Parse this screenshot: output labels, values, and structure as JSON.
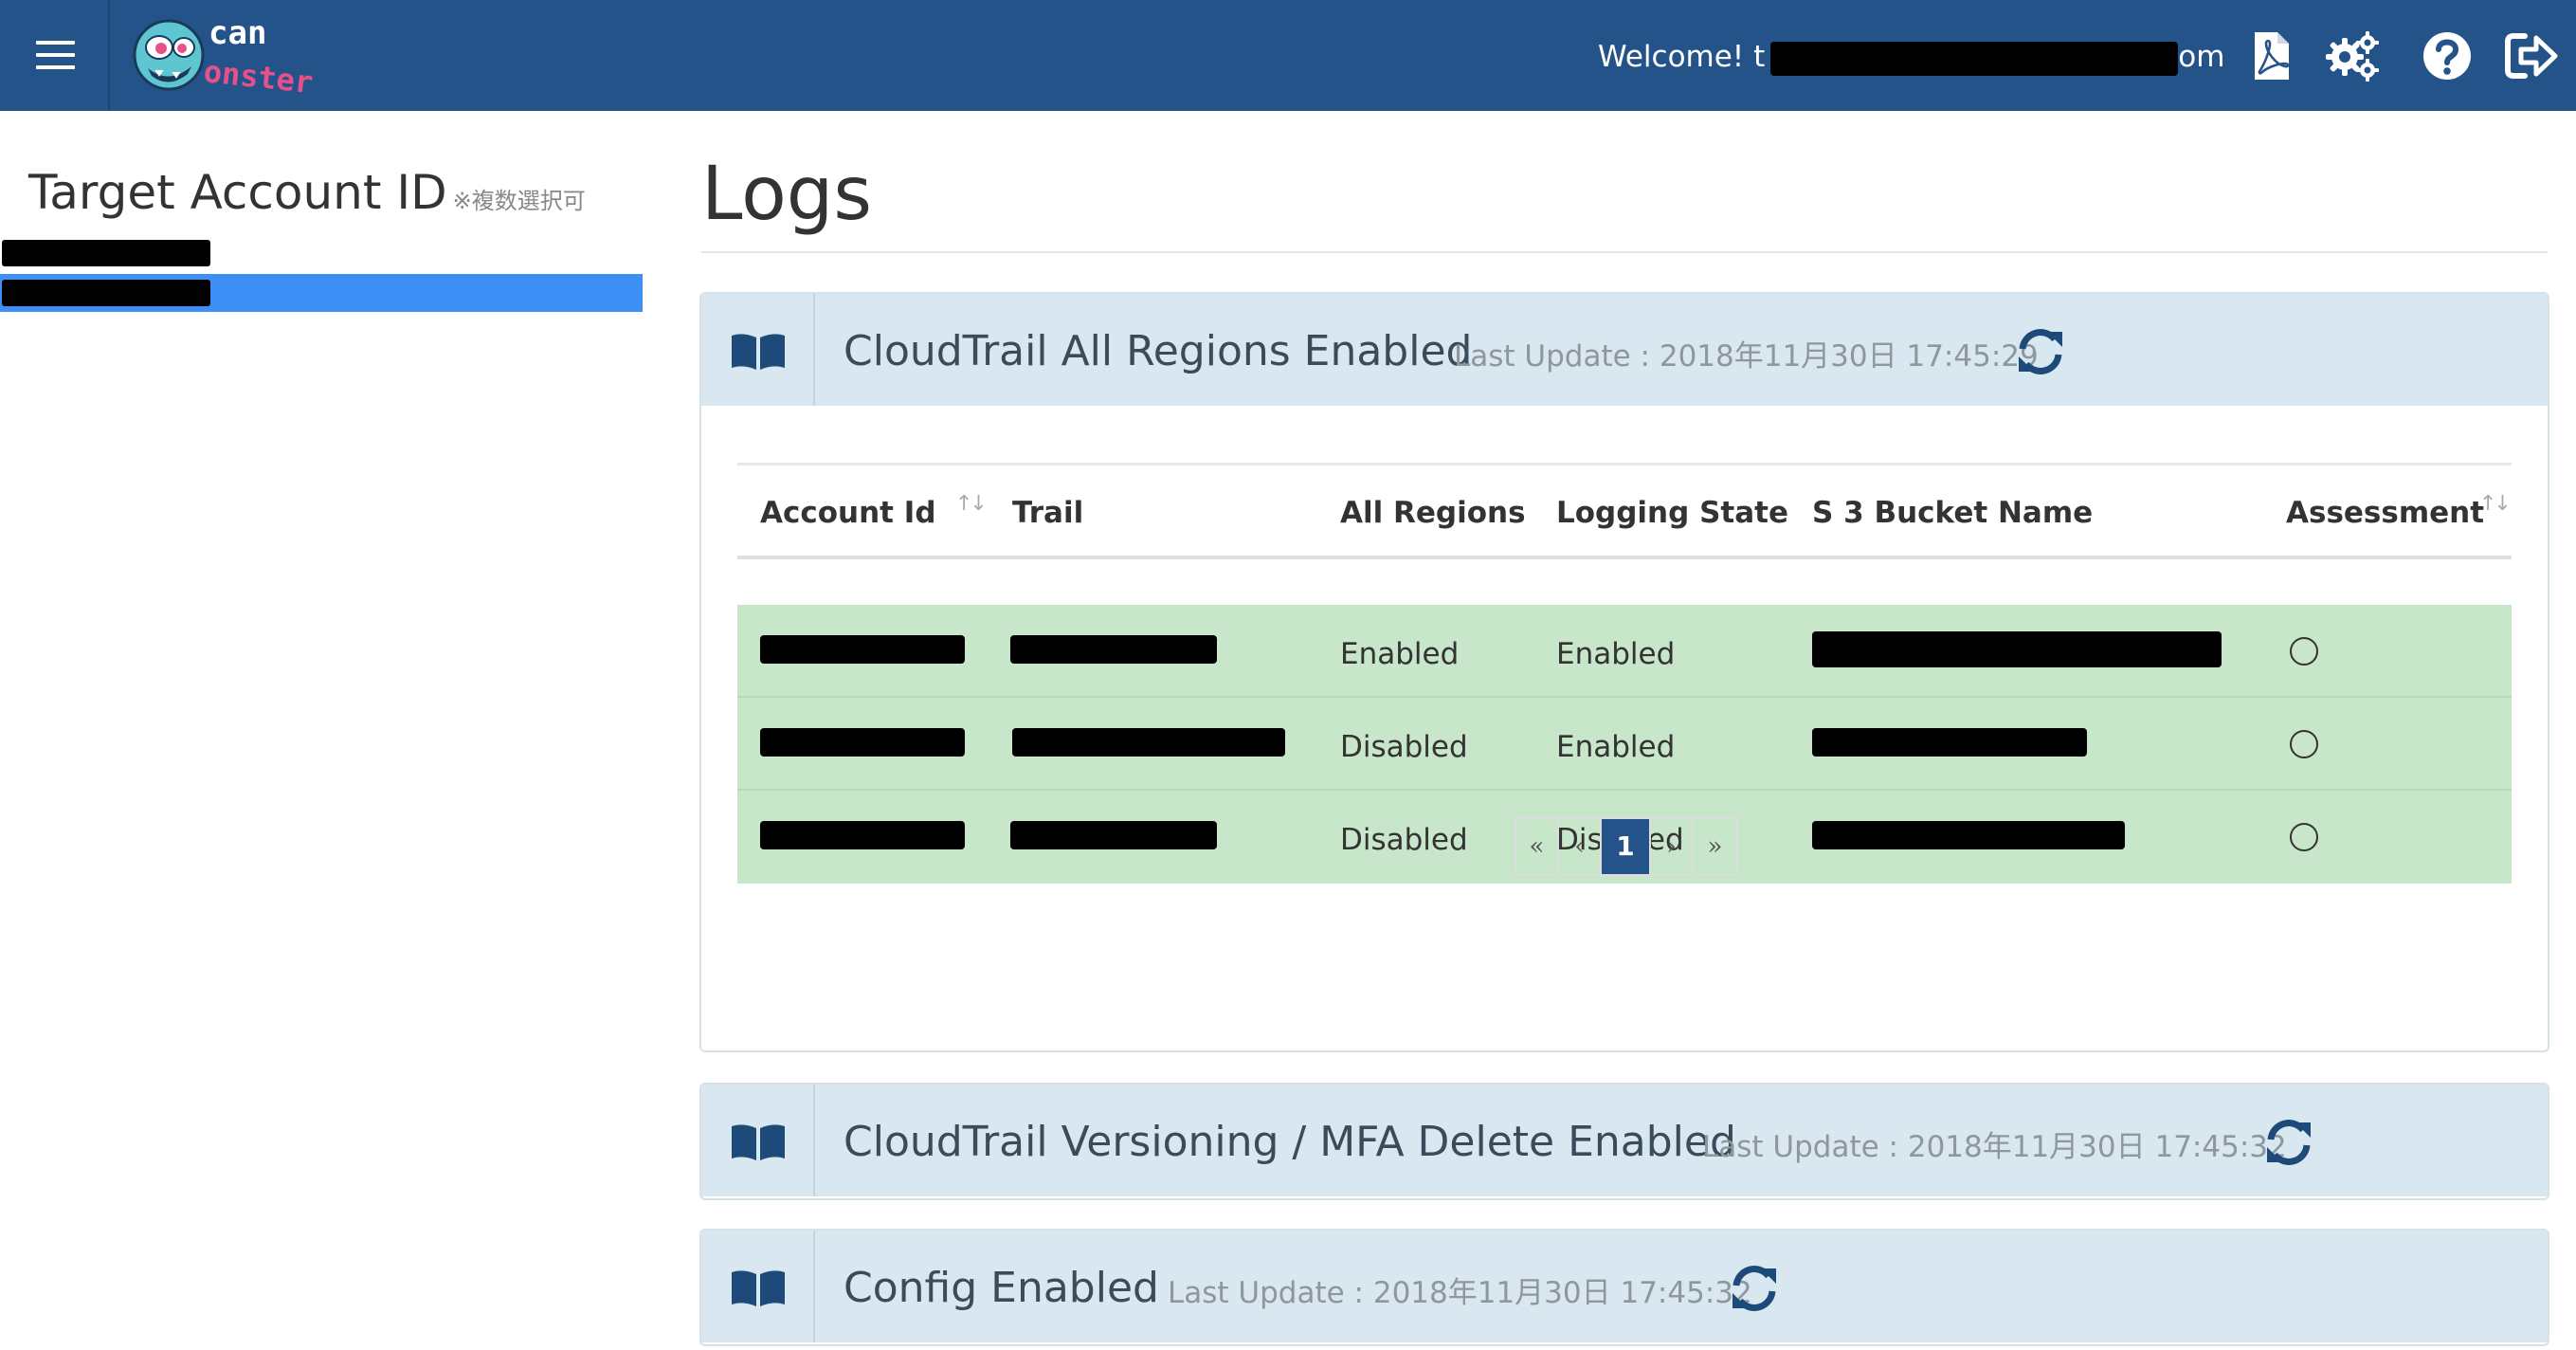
{
  "navbar": {
    "welcome_prefix": "Welcome! t",
    "welcome_suffix": "om",
    "icons": [
      "pdf-icon",
      "settings-icon",
      "help-icon",
      "logout-icon"
    ],
    "logo_text_1": "can",
    "logo_text_2": "onster"
  },
  "sidebar": {
    "title": "Target Account ID",
    "note": "※複数選択可",
    "accounts": [
      {
        "selected": false
      },
      {
        "selected": true
      }
    ]
  },
  "main": {
    "page_title": "Logs",
    "panels": [
      {
        "title": "CloudTrail All Regions Enabled",
        "last_update": "Last Update : 2018年11月30日 17:45:29",
        "expanded": true
      },
      {
        "title": "CloudTrail Versioning / MFA Delete Enabled",
        "last_update": "Last Update : 2018年11月30日 17:45:32",
        "expanded": false
      },
      {
        "title": "Config Enabled",
        "last_update": "Last Update : 2018年11月30日 17:45:32",
        "expanded": false
      }
    ],
    "table": {
      "headers": {
        "account_id": "Account Id",
        "trail": "Trail",
        "all_regions": "All Regions",
        "logging_state": "Logging State",
        "s3_bucket": "S 3 Bucket Name",
        "assessment": "Assessment"
      },
      "sort_glyph": "↑↓",
      "rows": [
        {
          "all_regions": "Enabled",
          "logging_state": "Enabled",
          "assessment": "○"
        },
        {
          "all_regions": "Disabled",
          "logging_state": "Enabled",
          "assessment": "○"
        },
        {
          "all_regions": "Disabled",
          "logging_state": "Disabled",
          "assessment": "○"
        }
      ]
    },
    "pagination": {
      "first": "«",
      "prev": "‹",
      "current": "1",
      "next": "›",
      "last": "»"
    }
  },
  "colors": {
    "navbar": "#24538a",
    "selected_row": "#3d8ff5",
    "panel_header": "#d9e8f0",
    "row_highlight": "#c8e6c9"
  }
}
